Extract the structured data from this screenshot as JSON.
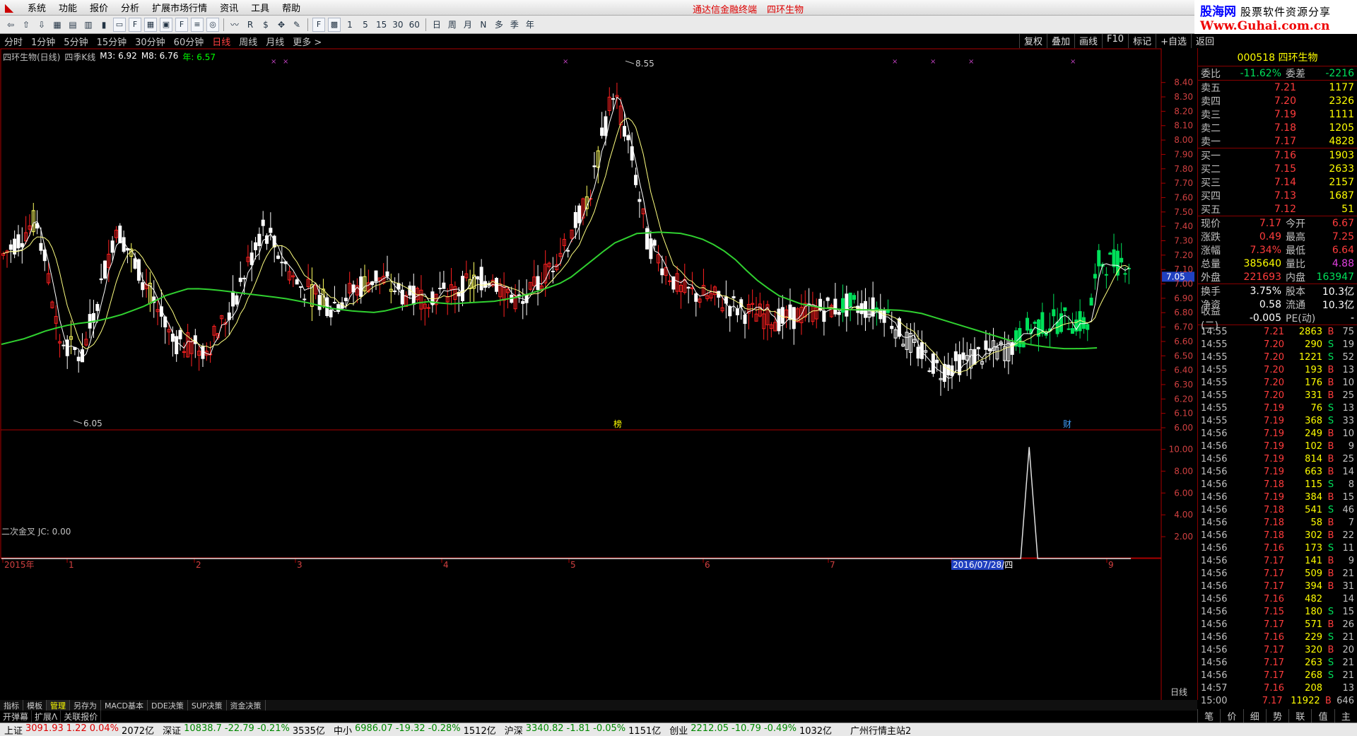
{
  "menubar": {
    "items": [
      "系统",
      "功能",
      "报价",
      "分析",
      "扩展市场行情",
      "资讯",
      "工具",
      "帮助"
    ],
    "title_app": "通达信金融终端",
    "title_stock": "四环生物"
  },
  "brand": {
    "name": "股海网",
    "slogan": "股票软件资源分享",
    "url": "Www.Guhai.com.cn"
  },
  "toolbar": {
    "numbers": [
      "1",
      "5",
      "15",
      "30",
      "60"
    ],
    "periods": [
      "日",
      "周",
      "月",
      "N",
      "多",
      "季",
      "年"
    ]
  },
  "periodbar": {
    "items": [
      "分时",
      "1分钟",
      "5分钟",
      "15分钟",
      "30分钟",
      "60分钟",
      "日线",
      "周线",
      "月线",
      "更多 >"
    ],
    "active": "日线",
    "right": [
      "复权",
      "叠加",
      "画线",
      "F10",
      "标记",
      "+自选",
      "返回"
    ]
  },
  "main_panel": {
    "title": "四环生物(日线)",
    "formula": "四季K线",
    "m3_label": "M3: 6.92",
    "m8_label": "M8: 6.76",
    "year_label": "年: 6.57",
    "high_label": "8.55",
    "low_label": "6.05",
    "marker1": "榜",
    "marker2": "财",
    "price_marker": "7.05"
  },
  "sub_panel": {
    "title": "二次金叉",
    "jc_label": "JC: 0.00"
  },
  "chart_data": {
    "type": "candlestick",
    "main_ylim": [
      6.0,
      8.6
    ],
    "main_yticks": [
      "8.40",
      "8.30",
      "8.20",
      "8.10",
      "8.00",
      "7.90",
      "7.80",
      "7.70",
      "7.60",
      "7.50",
      "7.40",
      "7.30",
      "7.20",
      "7.10",
      "7.00",
      "6.90",
      "6.80",
      "6.70",
      "6.60",
      "6.50",
      "6.40",
      "6.30",
      "6.20",
      "6.10",
      "6.00"
    ],
    "sub_ylim": [
      0,
      11
    ],
    "sub_yticks": [
      "10.00",
      "8.00",
      "6.00",
      "4.00",
      "2.00"
    ],
    "x_labels": [
      "2015年",
      "1",
      "2",
      "3",
      "4",
      "5",
      "6",
      "7",
      "2016/07/28/四",
      "9"
    ],
    "jc_spike": {
      "index": 0.91,
      "value": 10.2
    },
    "year_line": [
      6.58,
      6.62,
      6.68,
      6.72,
      6.74,
      6.78,
      6.84,
      6.92,
      6.97,
      6.96,
      6.94,
      6.92,
      6.9,
      6.87,
      6.83,
      6.81,
      6.8,
      6.84,
      6.88,
      6.86,
      6.87,
      6.88,
      6.91,
      6.96,
      7.02,
      7.15,
      7.28,
      7.35,
      7.36,
      7.35,
      7.3,
      7.2,
      7.04,
      6.92,
      6.86,
      6.83,
      6.82,
      6.82,
      6.82,
      6.8,
      6.75,
      6.7,
      6.65,
      6.6,
      6.57,
      6.55,
      6.55,
      6.56,
      6.57
    ]
  },
  "quote": {
    "header": "000518 四环生物",
    "weibi": {
      "label": "委比",
      "value": "-11.62%",
      "label2": "委差",
      "value2": "-2216"
    },
    "sells": [
      {
        "l": "卖五",
        "p": "7.21",
        "q": "1177"
      },
      {
        "l": "卖四",
        "p": "7.20",
        "q": "2326"
      },
      {
        "l": "卖三",
        "p": "7.19",
        "q": "1111"
      },
      {
        "l": "卖二",
        "p": "7.18",
        "q": "1205"
      },
      {
        "l": "卖一",
        "p": "7.17",
        "q": "4828"
      }
    ],
    "buys": [
      {
        "l": "买一",
        "p": "7.16",
        "q": "1903"
      },
      {
        "l": "买二",
        "p": "7.15",
        "q": "2633"
      },
      {
        "l": "买三",
        "p": "7.14",
        "q": "2157"
      },
      {
        "l": "买四",
        "p": "7.13",
        "q": "1687"
      },
      {
        "l": "买五",
        "p": "7.12",
        "q": "51"
      }
    ],
    "stats": [
      {
        "l": "现价",
        "v": "7.17",
        "vc": "red",
        "l2": "今开",
        "v2": "6.67",
        "v2c": "red"
      },
      {
        "l": "涨跌",
        "v": "0.49",
        "vc": "red",
        "l2": "最高",
        "v2": "7.25",
        "v2c": "red"
      },
      {
        "l": "涨幅",
        "v": "7.34%",
        "vc": "red",
        "l2": "最低",
        "v2": "6.64",
        "v2c": "red"
      },
      {
        "l": "总量",
        "v": "385640",
        "vc": "yellow",
        "l2": "量比",
        "v2": "4.88",
        "v2c": "magenta"
      },
      {
        "l": "外盘",
        "v": "221693",
        "vc": "red",
        "l2": "内盘",
        "v2": "163947",
        "v2c": "green"
      }
    ],
    "stats2": [
      {
        "l": "换手",
        "v": "3.75%",
        "vc": "white",
        "l2": "股本",
        "v2": "10.3亿",
        "v2c": "white"
      },
      {
        "l": "净资",
        "v": "0.58",
        "vc": "white",
        "l2": "流通",
        "v2": "10.3亿",
        "v2c": "white"
      },
      {
        "l": "收益(二)",
        "v": "-0.005",
        "vc": "white",
        "l2": "PE(动)",
        "v2": "-",
        "v2c": "white"
      }
    ],
    "ticks": [
      {
        "t": "14:55",
        "p": "7.21",
        "v": "2863",
        "b": "B",
        "n": "75"
      },
      {
        "t": "14:55",
        "p": "7.20",
        "v": "290",
        "b": "S",
        "n": "19"
      },
      {
        "t": "14:55",
        "p": "7.20",
        "v": "1221",
        "b": "S",
        "n": "52"
      },
      {
        "t": "14:55",
        "p": "7.20",
        "v": "193",
        "b": "B",
        "n": "13"
      },
      {
        "t": "14:55",
        "p": "7.20",
        "v": "176",
        "b": "B",
        "n": "10"
      },
      {
        "t": "14:55",
        "p": "7.20",
        "v": "331",
        "b": "B",
        "n": "25"
      },
      {
        "t": "14:55",
        "p": "7.19",
        "v": "76",
        "b": "S",
        "n": "13"
      },
      {
        "t": "14:55",
        "p": "7.19",
        "v": "368",
        "b": "S",
        "n": "33"
      },
      {
        "t": "14:56",
        "p": "7.19",
        "v": "249",
        "b": "B",
        "n": "10"
      },
      {
        "t": "14:56",
        "p": "7.19",
        "v": "102",
        "b": "B",
        "n": "9"
      },
      {
        "t": "14:56",
        "p": "7.19",
        "v": "814",
        "b": "B",
        "n": "25"
      },
      {
        "t": "14:56",
        "p": "7.19",
        "v": "663",
        "b": "B",
        "n": "14"
      },
      {
        "t": "14:56",
        "p": "7.18",
        "v": "115",
        "b": "S",
        "n": "8"
      },
      {
        "t": "14:56",
        "p": "7.19",
        "v": "384",
        "b": "B",
        "n": "15"
      },
      {
        "t": "14:56",
        "p": "7.18",
        "v": "541",
        "b": "S",
        "n": "46"
      },
      {
        "t": "14:56",
        "p": "7.18",
        "v": "58",
        "b": "B",
        "n": "7"
      },
      {
        "t": "14:56",
        "p": "7.18",
        "v": "302",
        "b": "B",
        "n": "22"
      },
      {
        "t": "14:56",
        "p": "7.16",
        "v": "173",
        "b": "S",
        "n": "11"
      },
      {
        "t": "14:56",
        "p": "7.17",
        "v": "141",
        "b": "B",
        "n": "9"
      },
      {
        "t": "14:56",
        "p": "7.17",
        "v": "509",
        "b": "B",
        "n": "21"
      },
      {
        "t": "14:56",
        "p": "7.17",
        "v": "394",
        "b": "B",
        "n": "31"
      },
      {
        "t": "14:56",
        "p": "7.16",
        "v": "482",
        "b": "",
        "n": "14"
      },
      {
        "t": "14:56",
        "p": "7.15",
        "v": "180",
        "b": "S",
        "n": "15"
      },
      {
        "t": "14:56",
        "p": "7.17",
        "v": "571",
        "b": "B",
        "n": "26"
      },
      {
        "t": "14:56",
        "p": "7.16",
        "v": "229",
        "b": "S",
        "n": "21"
      },
      {
        "t": "14:56",
        "p": "7.17",
        "v": "320",
        "b": "B",
        "n": "20"
      },
      {
        "t": "14:56",
        "p": "7.17",
        "v": "263",
        "b": "S",
        "n": "21"
      },
      {
        "t": "14:56",
        "p": "7.17",
        "v": "268",
        "b": "S",
        "n": "21"
      },
      {
        "t": "14:57",
        "p": "7.16",
        "v": "208",
        "b": "",
        "n": "13"
      },
      {
        "t": "15:00",
        "p": "7.17",
        "v": "11922",
        "b": "B",
        "n": "646"
      }
    ],
    "tabs": [
      "笔",
      "价",
      "细",
      "势",
      "联",
      "值",
      "主"
    ]
  },
  "bottomtabs": [
    "指标",
    "模板",
    "管理",
    "另存为",
    "MACD基本",
    "DDE决策",
    "SUP决策",
    "资金决策"
  ],
  "bottomtabs_active": "管理",
  "footer": [
    "开弹幕",
    "扩展Λ",
    "关联报价"
  ],
  "period_right": "日线",
  "status": [
    {
      "nm": "上证",
      "v": "3091.93",
      "c": "1.22",
      "p": "0.04%",
      "a": "2072亿",
      "col": "r"
    },
    {
      "nm": "深证",
      "v": "10838.7",
      "c": "-22.79",
      "p": "-0.21%",
      "a": "3535亿",
      "col": "g"
    },
    {
      "nm": "中小",
      "v": "6986.07",
      "c": "-19.32",
      "p": "-0.28%",
      "a": "1512亿",
      "col": "g"
    },
    {
      "nm": "沪深",
      "v": "3340.82",
      "c": "-1.81",
      "p": "-0.05%",
      "a": "1151亿",
      "col": "g"
    },
    {
      "nm": "创业",
      "v": "2212.05",
      "c": "-10.79",
      "p": "-0.49%",
      "a": "1032亿",
      "col": "g"
    }
  ],
  "status_station": "广州行情主站2"
}
